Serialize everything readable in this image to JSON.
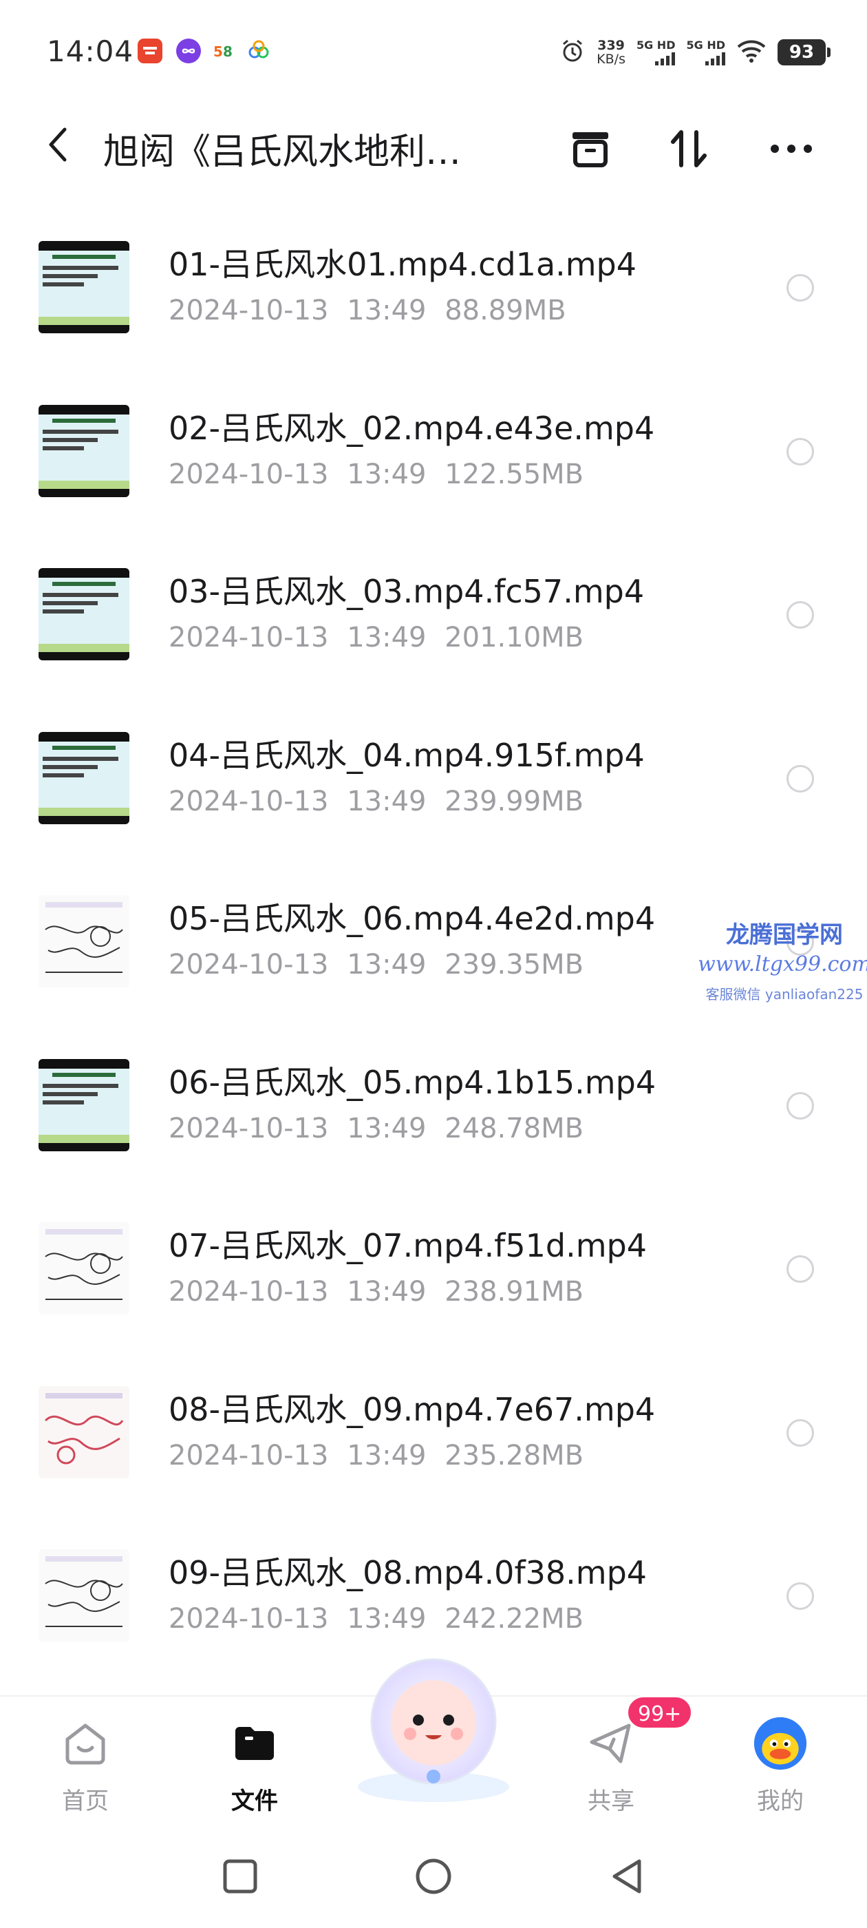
{
  "status_bar": {
    "time": "14:04",
    "net_speed_value": "339",
    "net_speed_unit": "KB/s",
    "signal1_label": "5G HD",
    "signal2_label": "5G HD",
    "battery": "93",
    "app_icons": [
      "toutiao-icon",
      "infinity-icon",
      "58-icon",
      "cloud-drive-icon"
    ]
  },
  "header": {
    "title": "旭闳《吕氏风水地利…",
    "back_icon": "chevron-left-icon",
    "archive_icon": "archive-icon",
    "sort_icon": "sort-icon",
    "more_icon": "more-icon"
  },
  "files": [
    {
      "name": "01-吕氏风水01.mp4.cd1a.mp4",
      "date": "2024-10-13",
      "time": "13:49",
      "size": "88.89MB",
      "thumb": "slide"
    },
    {
      "name": "02-吕氏风水_02.mp4.e43e.mp4",
      "date": "2024-10-13",
      "time": "13:49",
      "size": "122.55MB",
      "thumb": "slide"
    },
    {
      "name": "03-吕氏风水_03.mp4.fc57.mp4",
      "date": "2024-10-13",
      "time": "13:49",
      "size": "201.10MB",
      "thumb": "slide"
    },
    {
      "name": "04-吕氏风水_04.mp4.915f.mp4",
      "date": "2024-10-13",
      "time": "13:49",
      "size": "239.99MB",
      "thumb": "slide"
    },
    {
      "name": "05-吕氏风水_06.mp4.4e2d.mp4",
      "date": "2024-10-13",
      "time": "13:49",
      "size": "239.35MB",
      "thumb": "sketch"
    },
    {
      "name": "06-吕氏风水_05.mp4.1b15.mp4",
      "date": "2024-10-13",
      "time": "13:49",
      "size": "248.78MB",
      "thumb": "slide"
    },
    {
      "name": "07-吕氏风水_07.mp4.f51d.mp4",
      "date": "2024-10-13",
      "time": "13:49",
      "size": "238.91MB",
      "thumb": "sketch"
    },
    {
      "name": "08-吕氏风水_09.mp4.7e67.mp4",
      "date": "2024-10-13",
      "time": "13:49",
      "size": "235.28MB",
      "thumb": "sketch-red"
    },
    {
      "name": "09-吕氏风水_08.mp4.0f38.mp4",
      "date": "2024-10-13",
      "time": "13:49",
      "size": "242.22MB",
      "thumb": "sketch"
    }
  ],
  "watermark": {
    "title": "龙腾国学网",
    "url": "www.ltgx99.com",
    "contact": "客服微信 yanliaofan225"
  },
  "bottom_nav": {
    "items": [
      {
        "label": "首页",
        "icon": "home-icon",
        "active": false
      },
      {
        "label": "文件",
        "icon": "folder-icon",
        "active": true
      },
      {
        "label": "共享",
        "icon": "share-icon",
        "active": false
      },
      {
        "label": "我的",
        "icon": "avatar-icon",
        "active": false
      }
    ],
    "share_badge": "99+"
  },
  "colors": {
    "accent_badge": "#f2326b",
    "meta_text": "#9e9ea2",
    "watermark": "#4a6fd6"
  }
}
